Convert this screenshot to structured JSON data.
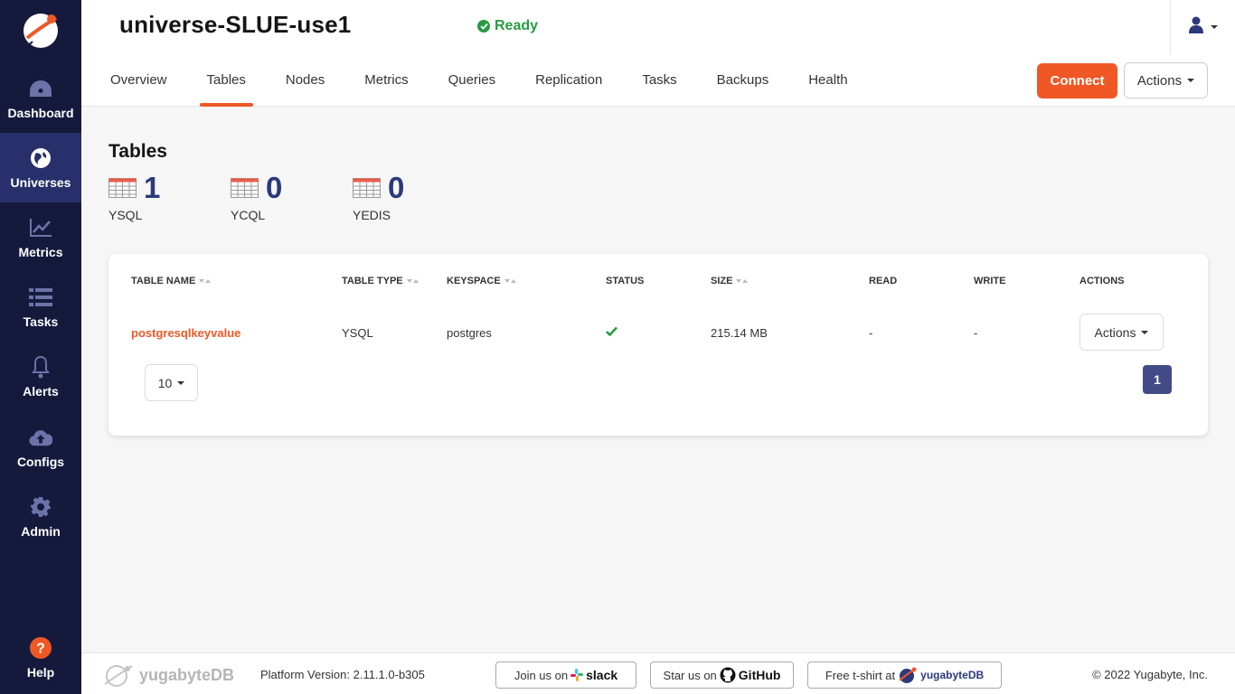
{
  "sidebar": {
    "items": [
      {
        "label": "Dashboard",
        "icon": "dashboard-icon"
      },
      {
        "label": "Universes",
        "icon": "globe-icon",
        "active": true
      },
      {
        "label": "Metrics",
        "icon": "chart-line-icon"
      },
      {
        "label": "Tasks",
        "icon": "list-icon"
      },
      {
        "label": "Alerts",
        "icon": "bell-icon"
      },
      {
        "label": "Configs",
        "icon": "cloud-upload-icon"
      },
      {
        "label": "Admin",
        "icon": "gear-icon"
      }
    ],
    "help_label": "Help"
  },
  "header": {
    "title": "universe-SLUE-use1",
    "status": "Ready",
    "tabs": [
      "Overview",
      "Tables",
      "Nodes",
      "Metrics",
      "Queries",
      "Replication",
      "Tasks",
      "Backups",
      "Health"
    ],
    "active_tab": "Tables",
    "connect_label": "Connect",
    "actions_label": "Actions"
  },
  "main": {
    "title": "Tables",
    "stats": [
      {
        "count": "1",
        "label": "YSQL"
      },
      {
        "count": "0",
        "label": "YCQL"
      },
      {
        "count": "0",
        "label": "YEDIS"
      }
    ],
    "table": {
      "columns": [
        "TABLE NAME",
        "TABLE TYPE",
        "KEYSPACE",
        "STATUS",
        "SIZE",
        "READ",
        "WRITE",
        "ACTIONS"
      ],
      "rows": [
        {
          "name": "postgresqlkeyvalue",
          "type": "YSQL",
          "keyspace": "postgres",
          "status": "ok",
          "size": "215.14 MB",
          "read": "-",
          "write": "-",
          "actions": "Actions"
        }
      ],
      "page_size": "10",
      "page": "1"
    }
  },
  "footer": {
    "brand": "yugabyteDB",
    "version": "Platform Version: 2.11.1.0-b305",
    "slack_prefix": "Join us on",
    "slack_brand": "slack",
    "github_prefix": "Star us on",
    "github_brand": "GitHub",
    "tshirt_prefix": "Free t-shirt at",
    "tshirt_brand": "yugabyteDB",
    "copyright": "© 2022 Yugabyte, Inc."
  },
  "colors": {
    "accent": "#ef5824",
    "sidebar": "#151a3d",
    "sidebar_active": "#27306a",
    "ready": "#289b42",
    "count": "#2b3a7a"
  }
}
